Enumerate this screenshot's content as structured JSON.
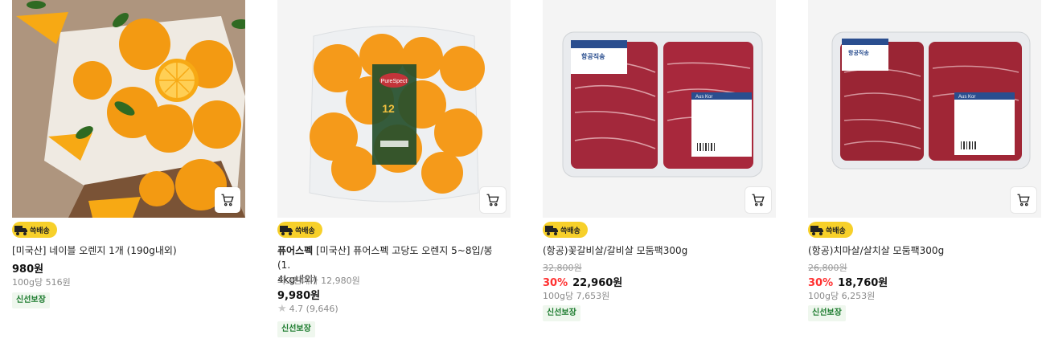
{
  "badge_label": "쓱배송",
  "fresh_label": "신선보장",
  "products": [
    {
      "title": "[미국산] 네이블 오렌지 1개 (190g내외)",
      "price": "980원",
      "unit_price": "100g당 516원"
    },
    {
      "brand": "퓨어스펙",
      "title": "[미국산] 퓨어스펙 고당도 오렌지 5~8입/봉 (1.",
      "title_line2": "4kg내외)",
      "highest_price": "최고판매가 12,980원",
      "price": "9,980원",
      "rating": "4.7 (9,646)",
      "package_label": "PureSpect",
      "package_count": "12"
    },
    {
      "title": "(항공)꽃갈비살/갈비살 모둠팩300g",
      "original_price": "32,800원",
      "discount": "30%",
      "price": "22,960원",
      "unit_price": "100g당 7,653원",
      "label_header": "항공직송",
      "label_brand": "Aus Kor"
    },
    {
      "title": "(항공)치마살/살치살 모둠팩300g",
      "original_price": "26,800원",
      "discount": "30%",
      "price": "18,760원",
      "unit_price": "100g당 6,253원",
      "label_header": "항공직송",
      "label_brand": "Aus Kor"
    }
  ],
  "icons": {
    "cart": "cart-icon",
    "truck": "delivery-truck-icon",
    "star": "star-icon"
  },
  "colors": {
    "badge": "#f7d02a",
    "discount": "#ff3030",
    "fresh_text": "#1a7a2c",
    "fresh_bg": "#eff7ee"
  }
}
